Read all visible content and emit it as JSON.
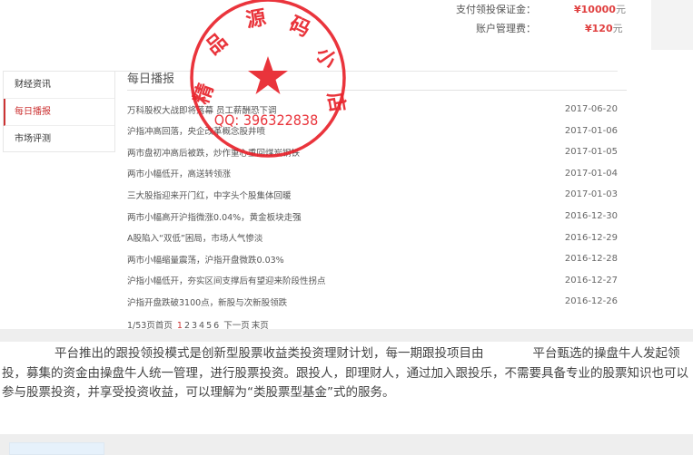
{
  "fees": [
    {
      "label": "支付领投保证金：",
      "amount": "¥10000",
      "unit": "元"
    },
    {
      "label": "账户管理费：",
      "amount": "¥120",
      "unit": "元"
    }
  ],
  "sidebar": {
    "items": [
      {
        "label": "财经资讯",
        "active": false
      },
      {
        "label": "每日播报",
        "active": true
      },
      {
        "label": "市场评测",
        "active": false
      }
    ]
  },
  "main": {
    "title": "每日播报",
    "news": [
      {
        "title": "万科股权大战即将落幕 员工薪酬恐下调",
        "date": "2017-06-20"
      },
      {
        "title": "沪指冲高回落，央企改革概念股井喷",
        "date": "2017-01-06"
      },
      {
        "title": "两市盘初冲高后被跌，炒作重心重回煤炭钢铁",
        "date": "2017-01-05"
      },
      {
        "title": "两市小幅低开，高送转领涨",
        "date": "2017-01-04"
      },
      {
        "title": "三大股指迎来开门红，中字头个股集体回暖",
        "date": "2017-01-03"
      },
      {
        "title": "两市小幅高开沪指微涨0.04%，黄金板块走强",
        "date": "2016-12-30"
      },
      {
        "title": "A股陷入“双低”困局，市场人气惨淡",
        "date": "2016-12-29"
      },
      {
        "title": "两市小幅缩量震荡，沪指开盘微跌0.03%",
        "date": "2016-12-28"
      },
      {
        "title": "沪指小幅低开，夯实区间支撑后有望迎来阶段性拐点",
        "date": "2016-12-27"
      },
      {
        "title": "沪指开盘跌破3100点，新股与次新股领跌",
        "date": "2016-12-26"
      }
    ],
    "pager": {
      "info": "1/53页",
      "first": "首页",
      "pages": [
        "1",
        "2",
        "3",
        "4",
        "5",
        "6"
      ],
      "next": "下一页",
      "last": "末页"
    }
  },
  "paragraph": "平台推出的跟投领投模式是创新型股票收益类投资理财计划，每一期跟投项目由　　　　平台甄选的操盘牛人发起领投，募集的资金由操盘牛人统一管理，进行股票投资。跟投人，即理财人，通过加入跟投乐，不需要具备专业的股票知识也可以参与股票投资，并享受投资收益，可以理解为“类股票型基金”式的服务。",
  "stamp": {
    "text": "精品源码小店",
    "qq": "QQ: 396322838",
    "color": "#e8232b"
  }
}
